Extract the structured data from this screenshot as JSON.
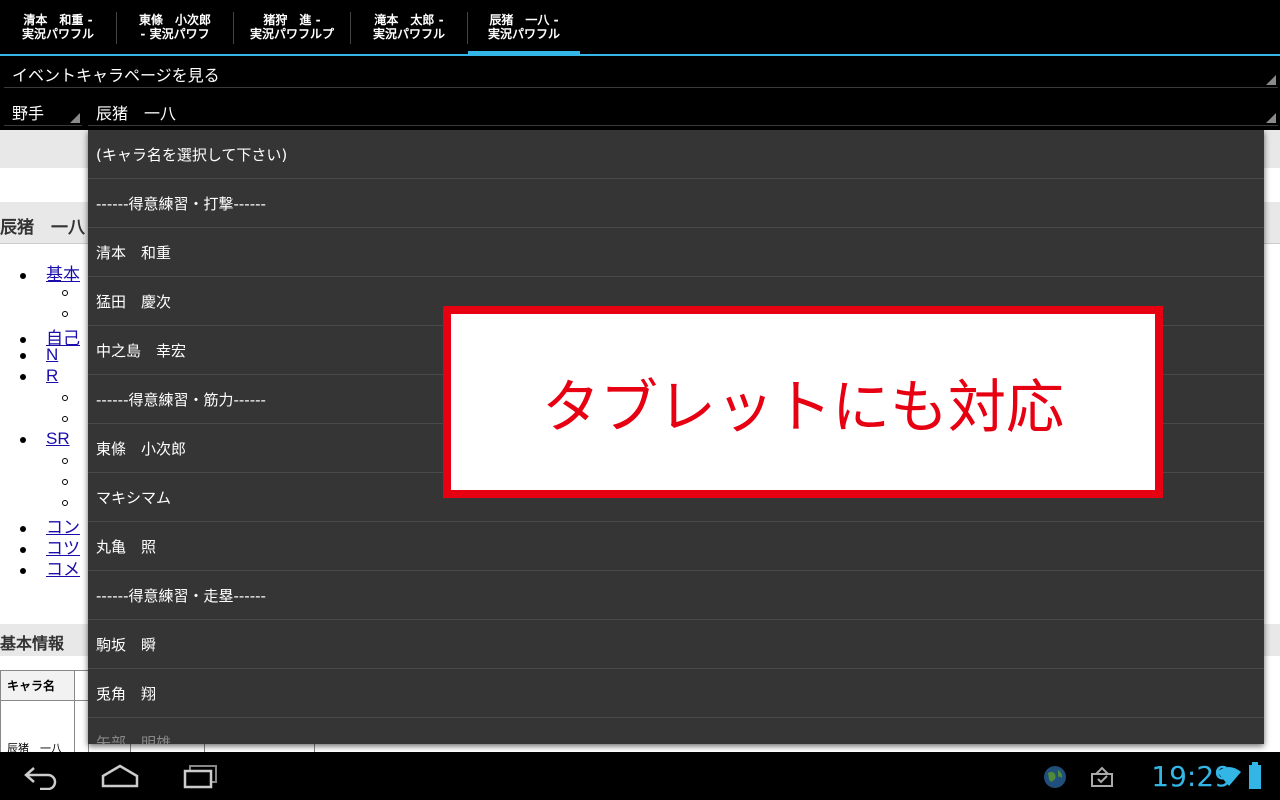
{
  "tabs": [
    {
      "label": "清本　和重 -\n実況パワフル"
    },
    {
      "label": "東條　小次郎\n- 実況パワフ"
    },
    {
      "label": "猪狩　進 -\n実況パワフルプ"
    },
    {
      "label": "滝本　太郎 -\n実況パワフル"
    },
    {
      "label": "辰猪　一八 -\n実況パワフル"
    }
  ],
  "event_spinner": {
    "label": "イベントキャラページを見る"
  },
  "position_spinner": {
    "label": "野手"
  },
  "character_spinner": {
    "label": "辰猪　一八"
  },
  "web": {
    "page_heading": "辰猪　一八",
    "toc": [
      {
        "label": "基本",
        "level": 1,
        "link": true
      },
      {
        "label": "",
        "level": 2
      },
      {
        "label": "",
        "level": 2
      },
      {
        "label": "自己",
        "level": 1,
        "link": true
      },
      {
        "label": "N",
        "level": 1,
        "link": true
      },
      {
        "label": "R",
        "level": 1,
        "link": true
      },
      {
        "label": "",
        "level": 2
      },
      {
        "label": "",
        "level": 2
      },
      {
        "label": "SR",
        "level": 1,
        "link": true
      },
      {
        "label": "",
        "level": 2
      },
      {
        "label": "",
        "level": 2
      },
      {
        "label": "",
        "level": 2
      },
      {
        "label": "コン",
        "level": 1,
        "link": true
      },
      {
        "label": "コツ",
        "level": 1,
        "link": true
      },
      {
        "label": "コメ",
        "level": 1,
        "link": true
      }
    ],
    "section_heading": "基本情報",
    "table": {
      "header": "キャラ名",
      "name_cell": "辰猪　一八"
    }
  },
  "dropdown": {
    "items": [
      {
        "label": "(キャラ名を選択して下さい)"
      },
      {
        "label": "------得意練習・打撃------"
      },
      {
        "label": "清本　和重"
      },
      {
        "label": "猛田　慶次"
      },
      {
        "label": "中之島　幸宏"
      },
      {
        "label": "------得意練習・筋力------"
      },
      {
        "label": "東條　小次郎"
      },
      {
        "label": "マキシマム"
      },
      {
        "label": "丸亀　照"
      },
      {
        "label": "------得意練習・走塁------"
      },
      {
        "label": "駒坂　瞬"
      },
      {
        "label": "兎角　翔"
      },
      {
        "label": "矢部　明雄"
      }
    ]
  },
  "promo": {
    "text": "タブレットにも対応"
  },
  "status": {
    "time": "19:29"
  },
  "colors": {
    "accent": "#33b5e5",
    "promo_red": "#e60012",
    "dropdown_bg": "#353535"
  }
}
